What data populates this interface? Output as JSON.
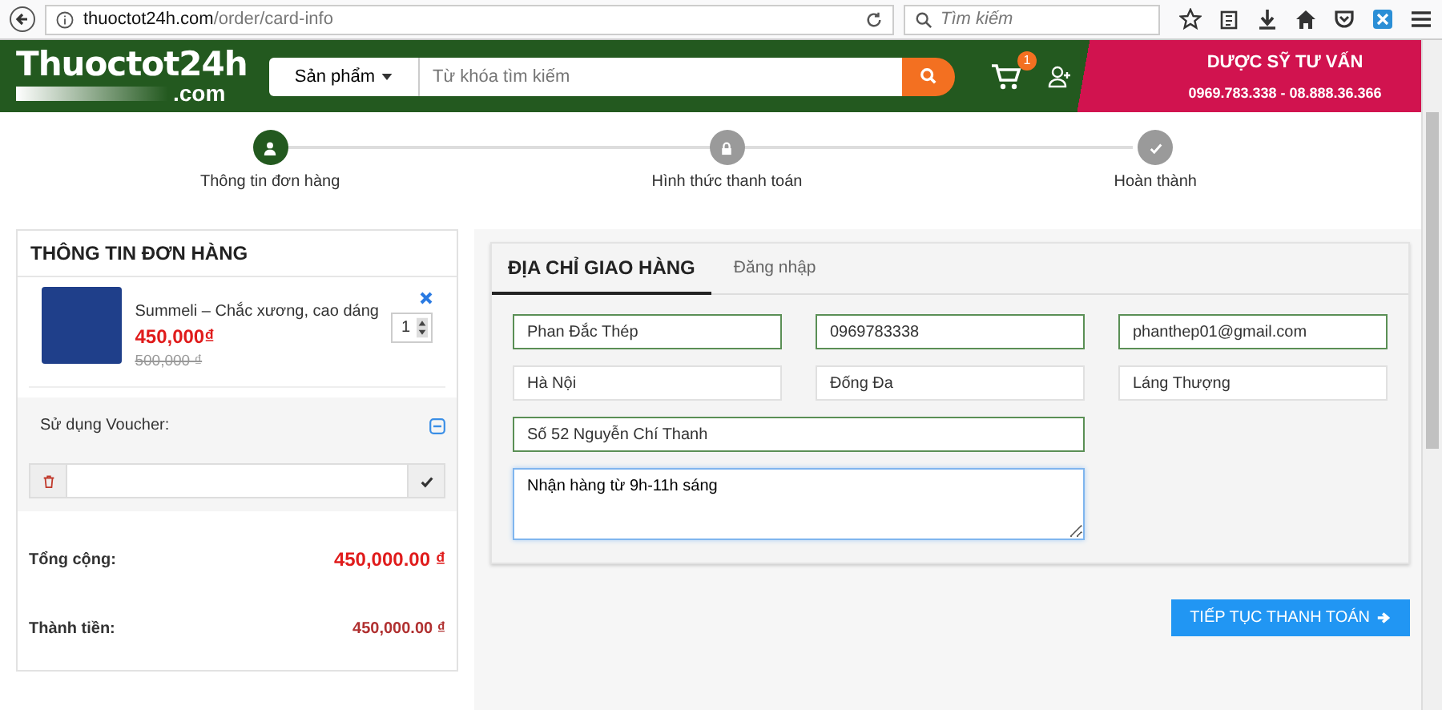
{
  "browser": {
    "url_host": "thuoctot24h.com",
    "url_path": "/order/card-info",
    "search_placeholder": "Tìm kiếm"
  },
  "header": {
    "logo_main": "Thuoctot24h",
    "logo_sub": ".com",
    "category": "Sản phẩm",
    "search_placeholder": "Từ khóa tìm kiếm",
    "cart_count": "1",
    "hotline_title": "DƯỢC SỸ TƯ VẤN",
    "hotline_numbers": "0969.783.338 - 08.888.36.366"
  },
  "steps": [
    {
      "label": "Thông tin đơn hàng",
      "selected": true
    },
    {
      "label": "Hình thức thanh toán",
      "selected": false
    },
    {
      "label": "Hoàn thành",
      "selected": false
    }
  ],
  "order": {
    "title": "THÔNG TIN ĐƠN HÀNG",
    "product": {
      "name": "Summeli – Chắc xương, cao dáng",
      "price": "450,000₫",
      "old_price": "500,000 ₫",
      "quantity": "1"
    },
    "voucher_label": "Sử dụng Voucher:",
    "voucher_expanded": true,
    "totals": [
      {
        "label": "Tổng cộng:",
        "value": "450,000.00 ₫",
        "kind": "large"
      },
      {
        "label": "Thành tiền:",
        "value": "450,000.00 ₫",
        "kind": "small"
      }
    ]
  },
  "tabs": [
    {
      "label": "ĐỊA CHỈ GIAO HÀNG",
      "selected": true
    },
    {
      "label": "Đăng nhập",
      "selected": false
    }
  ],
  "fields": [
    {
      "value": "Phan Đắc Thép",
      "valid": true,
      "wide": false
    },
    {
      "value": "0969783338",
      "valid": true,
      "wide": false
    },
    {
      "value": "phanthep01@gmail.com",
      "valid": true,
      "wide": false
    },
    {
      "value": "Hà Nội",
      "valid": false,
      "wide": false
    },
    {
      "value": "Đống Đa",
      "valid": false,
      "wide": false
    },
    {
      "value": "Láng Thượng",
      "valid": false,
      "wide": false
    },
    {
      "value": "Số 52 Nguyễn Chí Thanh",
      "valid": true,
      "wide": true
    }
  ],
  "note": {
    "value": "Nhận hàng từ 9h-11h sáng",
    "focused": true
  },
  "continue_button": "TIẾP TỤC THANH TOÁN"
}
